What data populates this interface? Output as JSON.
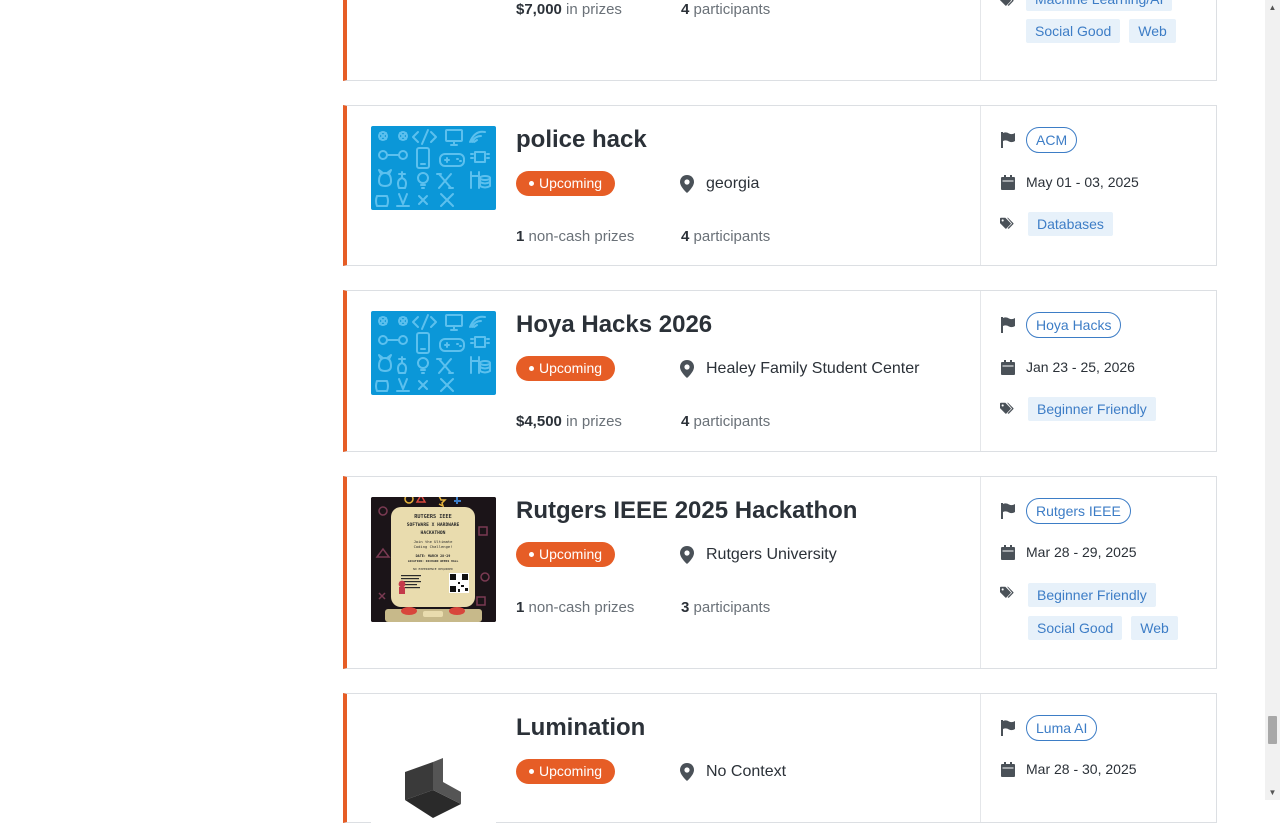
{
  "badge_label": "Upcoming",
  "colors": {
    "accent": "#e65d26",
    "link": "#3d7dc6",
    "tag_bg": "#e7f1fa"
  },
  "cards": [
    {
      "title": "",
      "prize_amount": "$7,000",
      "prize_suffix": " in prizes",
      "participants_count": "4",
      "participants_suffix": " participants",
      "tags": [
        "Machine Learning/AI",
        "Social Good",
        "Web"
      ]
    },
    {
      "title": "police hack",
      "location": "georgia",
      "prize_amount": "1",
      "prize_suffix": " non-cash prizes",
      "participants_count": "4",
      "participants_suffix": " participants",
      "host": "ACM",
      "dates": "May 01 - 03, 2025",
      "tags": [
        "Databases"
      ],
      "thumbnail_icon": "devpost-default-thumbnail"
    },
    {
      "title": "Hoya Hacks 2026",
      "location": "Healey Family Student Center",
      "prize_amount": "$4,500",
      "prize_suffix": " in prizes",
      "participants_count": "4",
      "participants_suffix": " participants",
      "host": "Hoya Hacks",
      "dates": "Jan 23 - 25, 2026",
      "tags": [
        "Beginner Friendly"
      ],
      "thumbnail_icon": "devpost-default-thumbnail"
    },
    {
      "title": "Rutgers IEEE 2025 Hackathon",
      "location": "Rutgers University",
      "prize_amount": "1",
      "prize_suffix": " non-cash prizes",
      "participants_count": "3",
      "participants_suffix": " participants",
      "host": "Rutgers IEEE",
      "dates": "Mar 28 - 29, 2025",
      "tags": [
        "Beginner Friendly",
        "Social Good",
        "Web"
      ],
      "thumbnail_icon": "rutgers-ieee-poster",
      "poster_lines": [
        "RUTGERS IEEE",
        "SOFTWARE X HARDWARE",
        "HACKATHON",
        "Join the Ultimate",
        "Coding Challenge!",
        "DATE: MARCH 28-29",
        "LOCATION: RICHARD WEEKS HALL",
        "NO EXPERIENCE REQUIRED"
      ]
    },
    {
      "title": "Lumination",
      "location": "No Context",
      "host": "Luma AI",
      "dates": "Mar 28 - 30, 2025",
      "thumbnail_icon": "lumination-logo"
    }
  ]
}
